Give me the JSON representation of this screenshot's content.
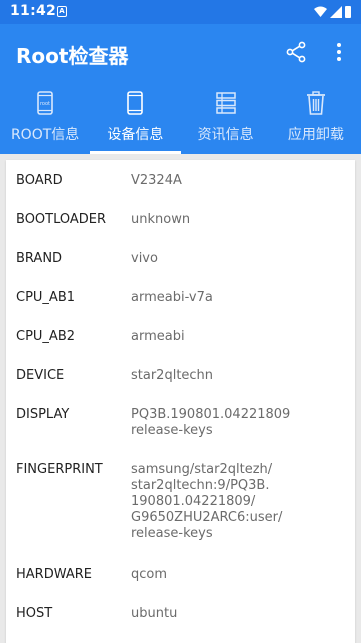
{
  "status_bar": {
    "time": "11:42",
    "notification_glyph": "A"
  },
  "app_bar": {
    "title": "Root检查器",
    "share_icon": "share-icon",
    "more_icon": "more-vertical-icon"
  },
  "tabs": [
    {
      "label": "ROOT信息",
      "icon": "root-phone-icon",
      "active": false
    },
    {
      "label": "设备信息",
      "icon": "smartphone-icon",
      "active": true
    },
    {
      "label": "资讯信息",
      "icon": "list-icon",
      "active": false
    },
    {
      "label": "应用卸载",
      "icon": "trash-icon",
      "active": false
    }
  ],
  "root_icon_text": "root",
  "device_info": [
    {
      "key": "BOARD",
      "lines": [
        "V2324A"
      ]
    },
    {
      "key": "BOOTLOADER",
      "lines": [
        "unknown"
      ]
    },
    {
      "key": "BRAND",
      "lines": [
        "vivo"
      ]
    },
    {
      "key": "CPU_AB1",
      "lines": [
        "armeabi-v7a"
      ]
    },
    {
      "key": "CPU_AB2",
      "lines": [
        "armeabi"
      ]
    },
    {
      "key": "DEVICE",
      "lines": [
        "star2qltechn"
      ]
    },
    {
      "key": "DISPLAY",
      "lines": [
        "PQ3B.190801.04221809",
        "release-keys"
      ]
    },
    {
      "key": "FINGERPRINT",
      "lines": [
        "samsung/star2qltezh/",
        "star2qltechn:9/PQ3B.",
        "190801.04221809/",
        "G9650ZHU2ARC6:user/",
        "release-keys"
      ]
    },
    {
      "key": "HARDWARE",
      "lines": [
        "qcom"
      ]
    },
    {
      "key": "HOST",
      "lines": [
        "ubuntu"
      ]
    }
  ],
  "colors": {
    "primary": "#2b86f0",
    "status_bar": "#2377e6",
    "background": "#e9e9e9"
  }
}
